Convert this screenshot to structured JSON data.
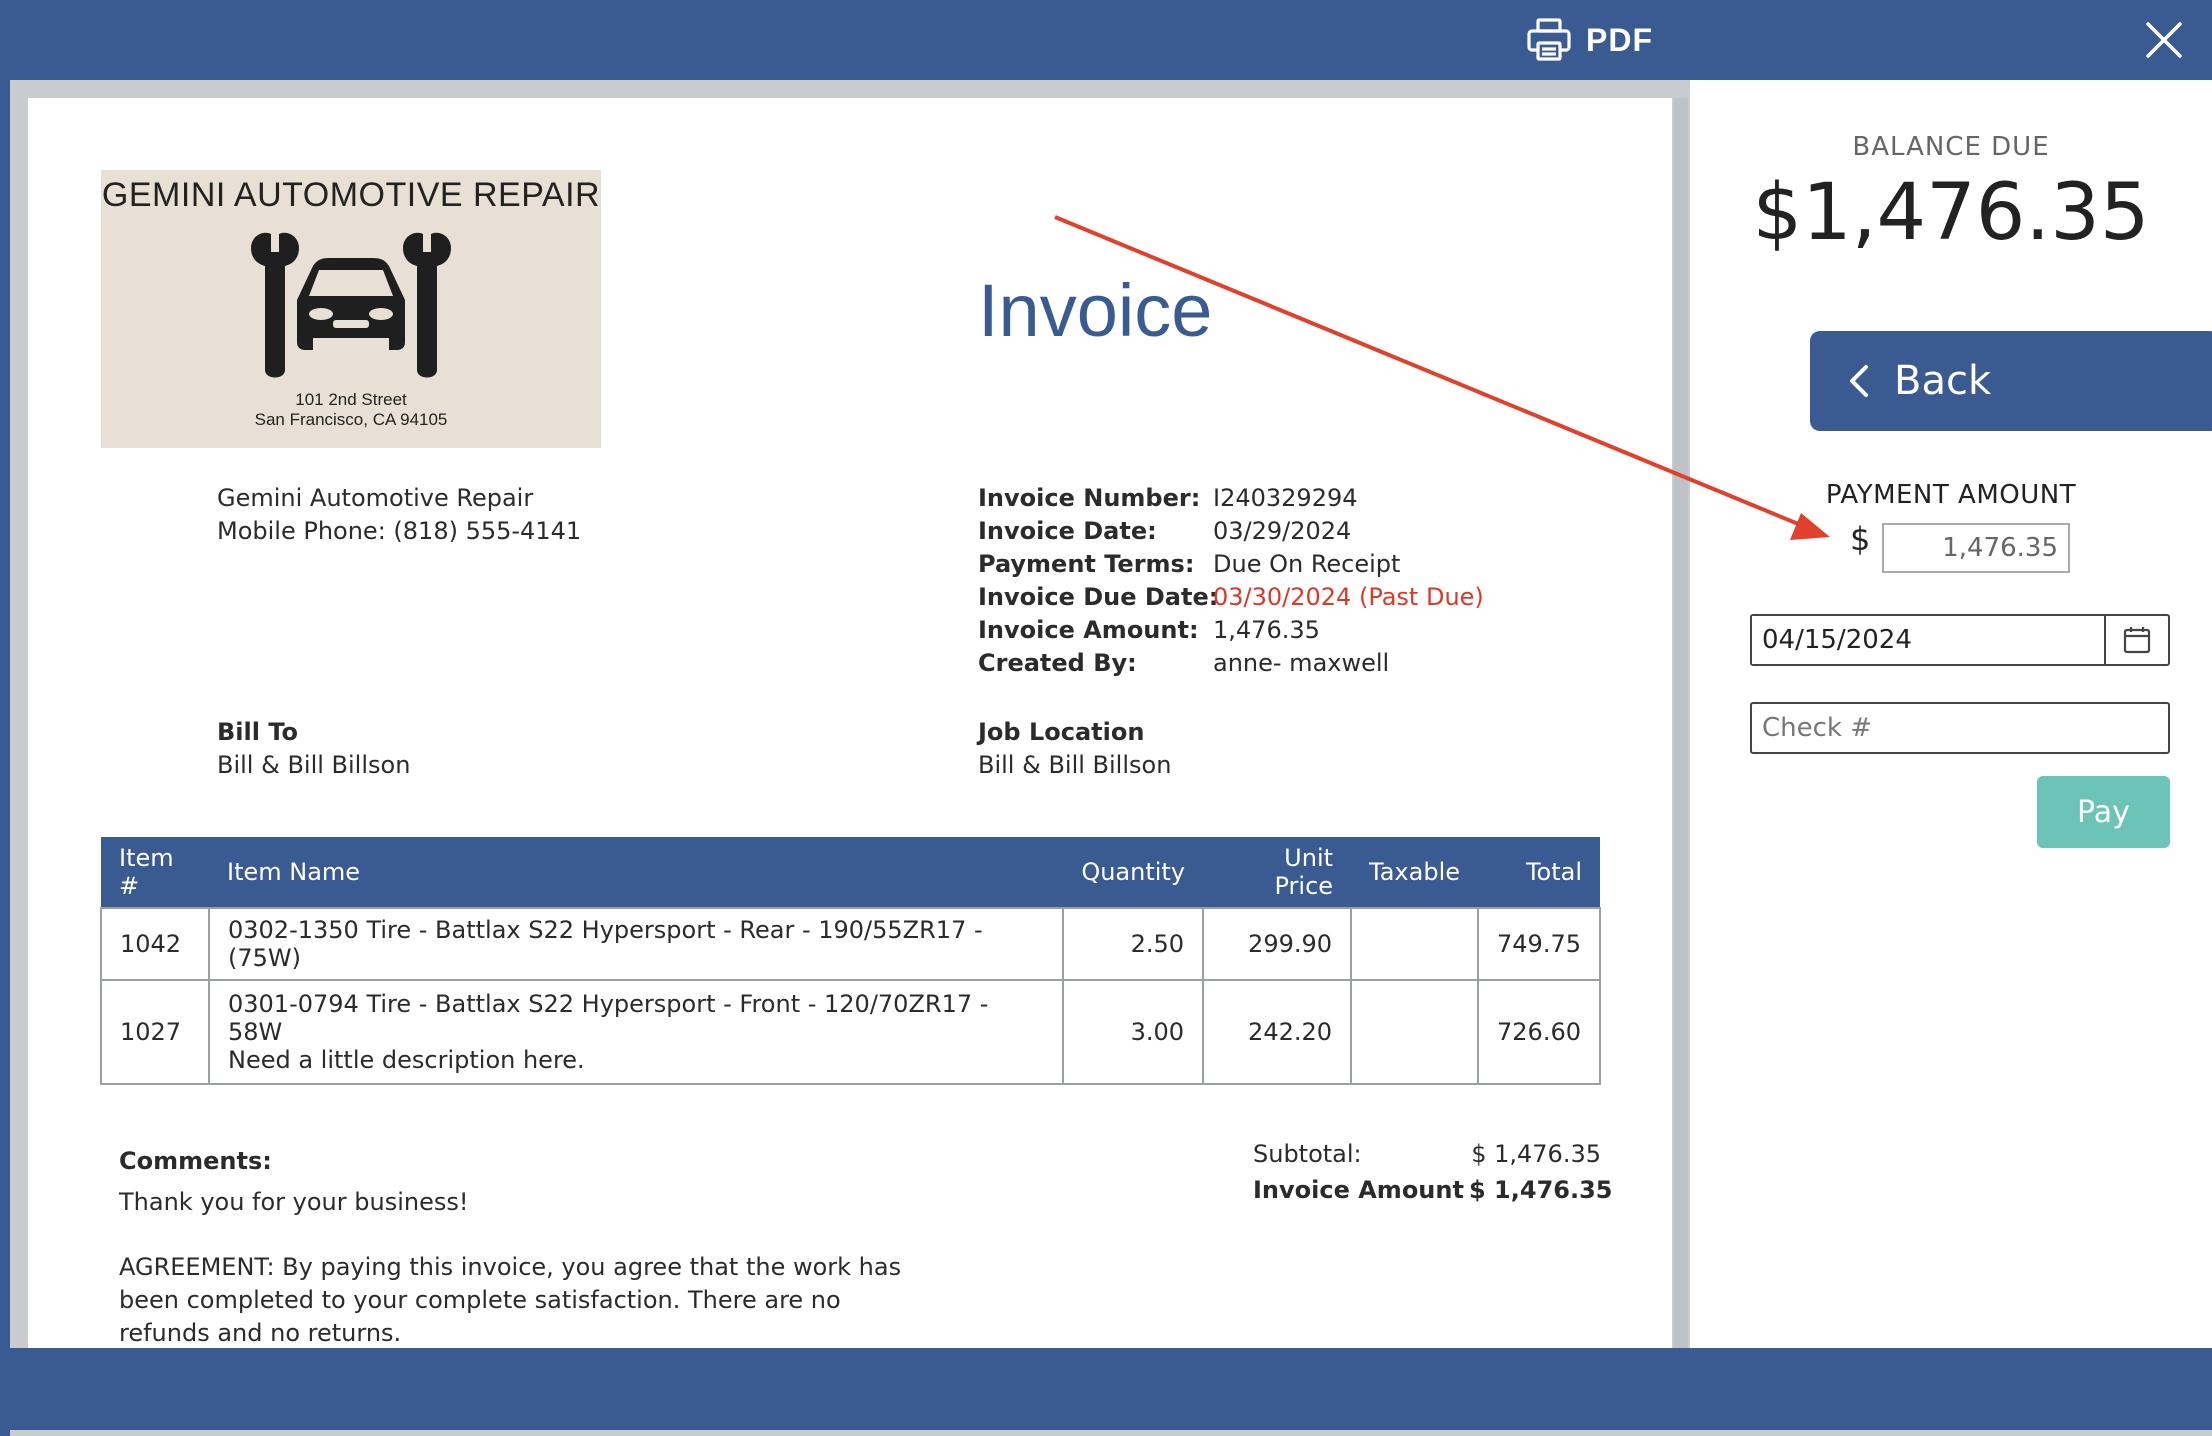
{
  "toolbar": {
    "pdf_label": "PDF"
  },
  "company": {
    "logo_title": "GEMINI AUTOMOTIVE REPAIR",
    "logo_address_line1": "101 2nd Street",
    "logo_address_line2": "San Francisco, CA  94105",
    "name": "Gemini Automotive Repair",
    "phone": "Mobile Phone: (818) 555-4141"
  },
  "invoice": {
    "title": "Invoice",
    "details": [
      {
        "label": "Invoice Number:",
        "value": "I240329294"
      },
      {
        "label": "Invoice Date:",
        "value": "03/29/2024"
      },
      {
        "label": "Payment Terms:",
        "value": "Due On Receipt"
      },
      {
        "label": "Invoice Due Date:",
        "value": "03/30/2024 (Past Due)"
      },
      {
        "label": "Invoice Amount:",
        "value": "1,476.35"
      },
      {
        "label": "Created By:",
        "value": "anne- maxwell"
      }
    ],
    "bill_to_label": "Bill To",
    "bill_to_value": "Bill & Bill Billson",
    "job_location_label": "Job Location",
    "job_location_value": "Bill & Bill Billson",
    "table": {
      "headers": [
        "Item #",
        "Item Name",
        "Quantity",
        "Unit Price",
        "Taxable",
        "Total"
      ],
      "rows": [
        {
          "item_no": "1042",
          "name": "0302-1350 Tire - Battlax S22 Hypersport - Rear - 190/55ZR17 - (75W)",
          "desc": "",
          "qty": "2.50",
          "unit_price": "299.90",
          "taxable": "",
          "total": "749.75"
        },
        {
          "item_no": "1027",
          "name": "0301-0794 Tire - Battlax S22 Hypersport - Front - 120/70ZR17 - 58W",
          "desc": "Need a little description here.",
          "qty": "3.00",
          "unit_price": "242.20",
          "taxable": "",
          "total": "726.60"
        }
      ]
    },
    "comments_label": "Comments:",
    "comments_text": "Thank you for your business!",
    "agreement_lines": [
      "AGREEMENT: By paying this invoice, you agree that the work has",
      "been completed to your complete satisfaction. There are no",
      "refunds and no returns."
    ],
    "subtotal_label": "Subtotal:",
    "subtotal_value": "$ 1,476.35",
    "amount_label": "Invoice Amount",
    "amount_value": "$ 1,476.35"
  },
  "payment": {
    "balance_label": "BALANCE DUE",
    "balance_amount": "$1,476.35",
    "back_label": "Back",
    "amount_label": "PAYMENT AMOUNT",
    "currency_symbol": "$",
    "amount_value": "1,476.35",
    "date_value": "04/15/2024",
    "check_placeholder": "Check #",
    "pay_label": "Pay"
  },
  "colors": {
    "brand": "#3a5a92",
    "past_due": "#d83a2a",
    "pay_button": "#6cc3b8",
    "annotation_arrow": "#e0412c"
  }
}
